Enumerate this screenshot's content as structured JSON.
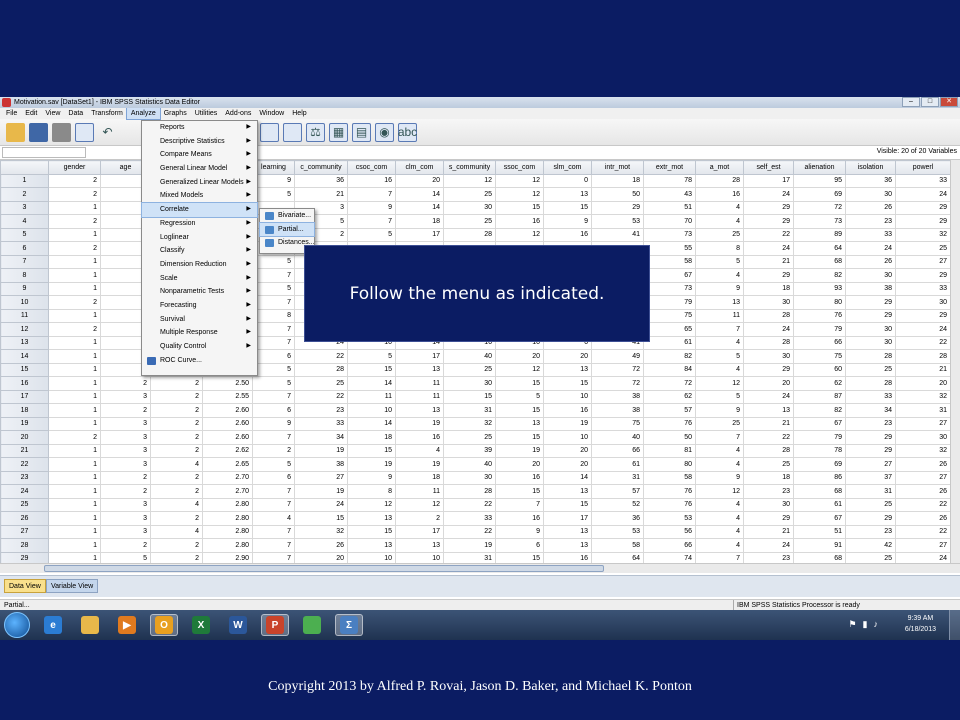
{
  "window": {
    "title": "Motivation.sav [DataSet1] - IBM SPSS Statistics Data Editor",
    "buttons": [
      "–",
      "□",
      "✕"
    ]
  },
  "menubar": [
    "File",
    "Edit",
    "View",
    "Data",
    "Transform",
    "Analyze",
    "Graphs",
    "Utilities",
    "Add-ons",
    "Window",
    "Help"
  ],
  "toolbar": {
    "icons": [
      "open-folder-icon",
      "save-icon",
      "print-icon",
      "dialog-recall-icon",
      "undo-icon",
      "goto-case-icon",
      "variables-icon",
      "split-file-icon",
      "weight-cases-icon",
      "select-cases-icon",
      "value-labels-icon",
      "use-sets-icon",
      "spelling-icon"
    ]
  },
  "formula_bar": {
    "visible_label": "Visible: 20 of 20 Variables"
  },
  "grid": {
    "columns": [
      "gender",
      "age",
      "",
      "",
      "learning",
      "c_community",
      "csoc_com",
      "clm_com",
      "s_community",
      "ssoc_com",
      "slm_com",
      "intr_mot",
      "extr_mot",
      "a_mot",
      "self_est",
      "alienation",
      "isolation",
      "powerl"
    ],
    "rows": [
      [
        "1",
        "2",
        "",
        "",
        "",
        "9",
        "36",
        "16",
        "20",
        "12",
        "12",
        "0",
        "18",
        "78",
        "28",
        "17",
        "95",
        "36",
        "33"
      ],
      [
        "2",
        "2",
        "",
        "",
        "",
        "5",
        "21",
        "7",
        "14",
        "25",
        "12",
        "13",
        "50",
        "43",
        "16",
        "24",
        "69",
        "30",
        "24"
      ],
      [
        "3",
        "1",
        "",
        "",
        "",
        "",
        "3",
        "9",
        "14",
        "30",
        "15",
        "15",
        "29",
        "51",
        "4",
        "29",
        "72",
        "26",
        "29"
      ],
      [
        "4",
        "2",
        "",
        "",
        "",
        "",
        "5",
        "7",
        "18",
        "25",
        "16",
        "9",
        "53",
        "70",
        "4",
        "29",
        "73",
        "23",
        "29"
      ],
      [
        "5",
        "1",
        "",
        "",
        "",
        "",
        "2",
        "5",
        "17",
        "28",
        "12",
        "16",
        "41",
        "73",
        "25",
        "22",
        "89",
        "33",
        "32"
      ],
      [
        "6",
        "2",
        "",
        "",
        "",
        "",
        "",
        "",
        "",
        "",
        "",
        "",
        "",
        "55",
        "8",
        "24",
        "64",
        "24",
        "25"
      ],
      [
        "7",
        "1",
        "",
        "",
        "",
        "5",
        "",
        "",
        "",
        "",
        "",
        "",
        "",
        "58",
        "5",
        "21",
        "68",
        "26",
        "27"
      ],
      [
        "8",
        "1",
        "",
        "",
        "",
        "7",
        "",
        "",
        "",
        "",
        "",
        "",
        "",
        "67",
        "4",
        "29",
        "82",
        "30",
        "29"
      ],
      [
        "9",
        "1",
        "",
        "",
        "",
        "5",
        "",
        "",
        "",
        "",
        "",
        "",
        "",
        "73",
        "9",
        "18",
        "93",
        "38",
        "33"
      ],
      [
        "10",
        "2",
        "",
        "",
        "",
        "7",
        "",
        "",
        "",
        "",
        "",
        "",
        "",
        "79",
        "13",
        "30",
        "80",
        "29",
        "30"
      ],
      [
        "11",
        "1",
        "",
        "",
        "",
        "8",
        "",
        "",
        "",
        "",
        "",
        "",
        "",
        "75",
        "11",
        "28",
        "76",
        "29",
        "29"
      ],
      [
        "12",
        "2",
        "",
        "",
        "",
        "7",
        "",
        "",
        "",
        "",
        "",
        "",
        "",
        "65",
        "7",
        "24",
        "79",
        "30",
        "24"
      ],
      [
        "13",
        "1",
        "",
        "",
        "",
        "7",
        "24",
        "10",
        "14",
        "16",
        "10",
        "6",
        "41",
        "61",
        "4",
        "28",
        "66",
        "30",
        "22"
      ],
      [
        "14",
        "1",
        "",
        "",
        "",
        "6",
        "22",
        "5",
        "17",
        "40",
        "20",
        "20",
        "49",
        "82",
        "5",
        "30",
        "75",
        "28",
        "28"
      ],
      [
        "15",
        "1",
        "",
        "",
        "",
        "5",
        "28",
        "15",
        "13",
        "25",
        "12",
        "13",
        "72",
        "84",
        "4",
        "29",
        "60",
        "25",
        "21"
      ],
      [
        "16",
        "1",
        "2",
        "2",
        "2.50",
        "5",
        "25",
        "14",
        "11",
        "30",
        "15",
        "15",
        "72",
        "72",
        "12",
        "20",
        "62",
        "28",
        "20"
      ],
      [
        "17",
        "1",
        "3",
        "2",
        "2.55",
        "7",
        "22",
        "11",
        "11",
        "15",
        "5",
        "10",
        "38",
        "62",
        "5",
        "24",
        "87",
        "33",
        "32"
      ],
      [
        "18",
        "1",
        "2",
        "2",
        "2.60",
        "6",
        "23",
        "10",
        "13",
        "31",
        "15",
        "16",
        "38",
        "57",
        "9",
        "13",
        "82",
        "34",
        "31"
      ],
      [
        "19",
        "1",
        "3",
        "2",
        "2.60",
        "9",
        "33",
        "14",
        "19",
        "32",
        "13",
        "19",
        "75",
        "76",
        "25",
        "21",
        "67",
        "23",
        "27"
      ],
      [
        "20",
        "2",
        "3",
        "2",
        "2.60",
        "7",
        "34",
        "18",
        "16",
        "25",
        "15",
        "10",
        "40",
        "50",
        "7",
        "22",
        "79",
        "29",
        "30"
      ],
      [
        "21",
        "1",
        "3",
        "2",
        "2.62",
        "2",
        "19",
        "15",
        "4",
        "39",
        "19",
        "20",
        "66",
        "81",
        "4",
        "28",
        "78",
        "29",
        "32"
      ],
      [
        "22",
        "1",
        "3",
        "4",
        "2.65",
        "5",
        "38",
        "19",
        "19",
        "40",
        "20",
        "20",
        "61",
        "80",
        "4",
        "25",
        "69",
        "27",
        "26"
      ],
      [
        "23",
        "1",
        "2",
        "2",
        "2.70",
        "6",
        "27",
        "9",
        "18",
        "30",
        "16",
        "14",
        "31",
        "58",
        "9",
        "18",
        "86",
        "37",
        "27"
      ],
      [
        "24",
        "1",
        "2",
        "2",
        "2.70",
        "7",
        "19",
        "8",
        "11",
        "28",
        "15",
        "13",
        "57",
        "76",
        "12",
        "23",
        "68",
        "31",
        "26"
      ],
      [
        "25",
        "1",
        "3",
        "4",
        "2.80",
        "7",
        "24",
        "12",
        "12",
        "22",
        "7",
        "15",
        "52",
        "76",
        "4",
        "30",
        "61",
        "25",
        "22"
      ],
      [
        "26",
        "1",
        "3",
        "2",
        "2.80",
        "4",
        "15",
        "13",
        "2",
        "33",
        "16",
        "17",
        "36",
        "53",
        "4",
        "29",
        "67",
        "29",
        "26"
      ],
      [
        "27",
        "1",
        "3",
        "4",
        "2.80",
        "7",
        "32",
        "15",
        "17",
        "22",
        "9",
        "13",
        "53",
        "56",
        "4",
        "21",
        "51",
        "23",
        "22"
      ],
      [
        "28",
        "1",
        "2",
        "2",
        "2.80",
        "7",
        "26",
        "13",
        "13",
        "19",
        "6",
        "13",
        "58",
        "66",
        "4",
        "24",
        "91",
        "42",
        "27"
      ],
      [
        "29",
        "1",
        "5",
        "2",
        "2.90",
        "7",
        "20",
        "10",
        "10",
        "31",
        "15",
        "16",
        "64",
        "74",
        "7",
        "23",
        "68",
        "25",
        "24"
      ]
    ]
  },
  "analyze_menu": {
    "items": [
      {
        "label": "Reports",
        "submenu": true
      },
      {
        "label": "Descriptive Statistics",
        "submenu": true
      },
      {
        "label": "Compare Means",
        "submenu": true
      },
      {
        "label": "General Linear Model",
        "submenu": true
      },
      {
        "label": "Generalized Linear Models",
        "submenu": true
      },
      {
        "label": "Mixed Models",
        "submenu": true
      },
      {
        "label": "Correlate",
        "submenu": true,
        "highlighted": true
      },
      {
        "label": "Regression",
        "submenu": true
      },
      {
        "label": "Loglinear",
        "submenu": true
      },
      {
        "label": "Classify",
        "submenu": true
      },
      {
        "label": "Dimension Reduction",
        "submenu": true
      },
      {
        "label": "Scale",
        "submenu": true
      },
      {
        "label": "Nonparametric Tests",
        "submenu": true
      },
      {
        "label": "Forecasting",
        "submenu": true
      },
      {
        "label": "Survival",
        "submenu": true
      },
      {
        "label": "Multiple Response",
        "submenu": true
      },
      {
        "label": "Quality Control",
        "submenu": true
      },
      {
        "label": "ROC Curve...",
        "submenu": false,
        "icon": true
      }
    ]
  },
  "correlate_menu": {
    "items": [
      {
        "label": "Bivariate...",
        "highlighted": false
      },
      {
        "label": "Partial...",
        "highlighted": true
      },
      {
        "label": "Distances...",
        "highlighted": false
      }
    ]
  },
  "callout": {
    "text": "Follow the menu as indicated."
  },
  "tabs": {
    "data_view": "Data View",
    "variable_view": "Variable View"
  },
  "status": {
    "left": "Partial...",
    "right": "IBM SPSS Statistics Processor is ready"
  },
  "taskbar": {
    "apps": [
      {
        "name": "ie-icon",
        "glyph": "e"
      },
      {
        "name": "explorer-icon",
        "glyph": ""
      },
      {
        "name": "media-player-icon",
        "glyph": "▶"
      },
      {
        "name": "outlook-icon",
        "glyph": "O",
        "active": true
      },
      {
        "name": "excel-icon",
        "glyph": "X"
      },
      {
        "name": "word-icon",
        "glyph": "W"
      },
      {
        "name": "powerpoint-icon",
        "glyph": "P",
        "active": true
      },
      {
        "name": "chrome-icon",
        "glyph": ""
      },
      {
        "name": "spss-icon",
        "glyph": "Σ",
        "active": true
      }
    ],
    "time": "9:39 AM",
    "date": "6/18/2013"
  },
  "colors": {
    "background": "#0b1c63",
    "menu_highlight": "#cfe2f7"
  },
  "footer": {
    "copyright": "Copyright 2013 by Alfred P. Rovai, Jason D. Baker, and Michael K. Ponton"
  }
}
